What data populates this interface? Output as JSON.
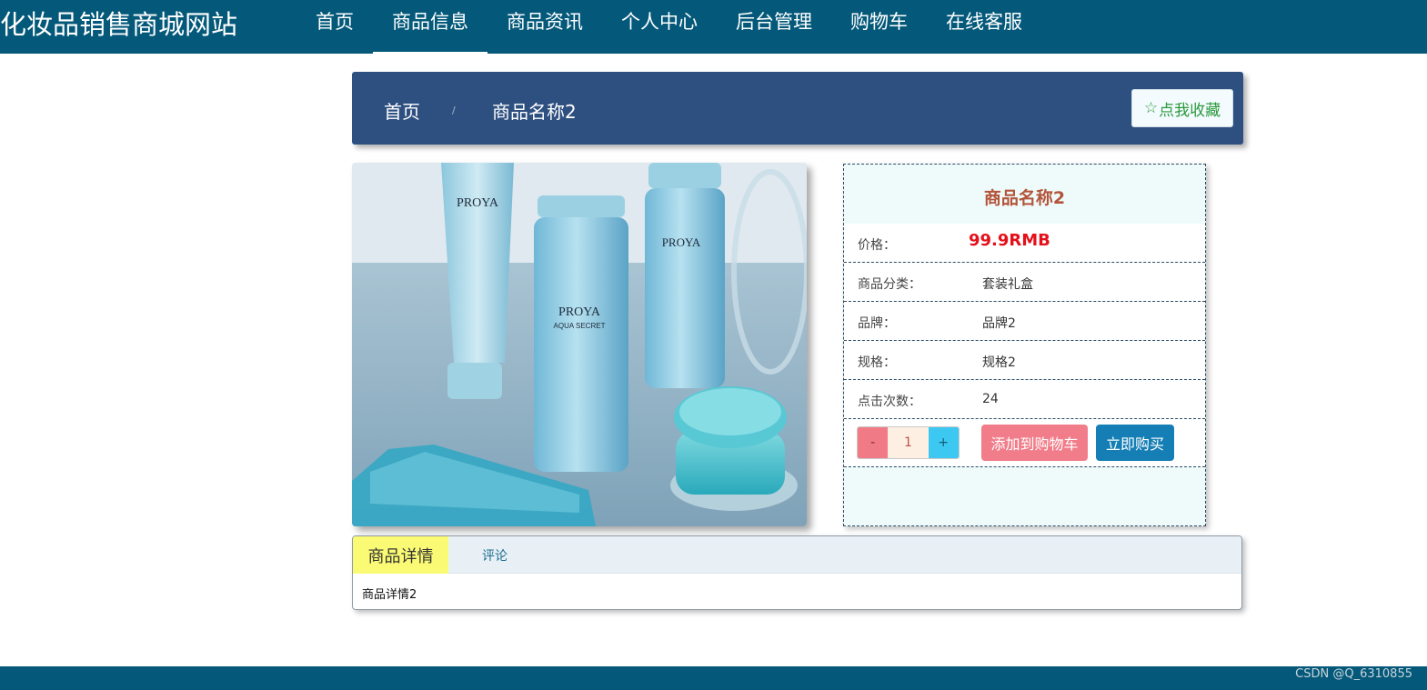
{
  "header": {
    "site_title": "化妆品销售商城网站",
    "nav": [
      {
        "label": "首页"
      },
      {
        "label": "商品信息"
      },
      {
        "label": "商品资讯"
      },
      {
        "label": "个人中心"
      },
      {
        "label": "后台管理"
      },
      {
        "label": "购物车"
      },
      {
        "label": "在线客服"
      }
    ],
    "active_nav": "商品信息"
  },
  "breadcrumb": {
    "home": "首页",
    "separator": "/",
    "current": "商品名称2",
    "favorite_label": "点我收藏",
    "favorite_icon": "star-outline-icon"
  },
  "product": {
    "name": "商品名称2",
    "price_label": "价格：",
    "price": "99.9RMB",
    "fields": [
      {
        "label": "商品分类：",
        "value": "套装礼盒"
      },
      {
        "label": "品牌：",
        "value": "品牌2"
      },
      {
        "label": "规格：",
        "value": "规格2"
      },
      {
        "label": "点击次数：",
        "value": "24"
      }
    ],
    "image_brand_text": [
      "PROYA",
      "AQUA SECRET"
    ],
    "quantity": "1",
    "minus_label": "-",
    "plus_label": "+",
    "add_to_cart_label": "添加到购物车",
    "buy_now_label": "立即购买"
  },
  "tabs": {
    "detail_label": "商品详情",
    "comment_label": "评论",
    "detail_content": "商品详情2"
  },
  "footer": {
    "watermark": "CSDN @Q_6310855"
  },
  "colors": {
    "nav_bg": "#04597a",
    "crumb_bg": "#2e5080",
    "price": "#e4101a",
    "title": "#b3553a",
    "cart_button": "#f17d8a",
    "buy_button": "#157fb5",
    "active_tab": "#fbfa74"
  }
}
